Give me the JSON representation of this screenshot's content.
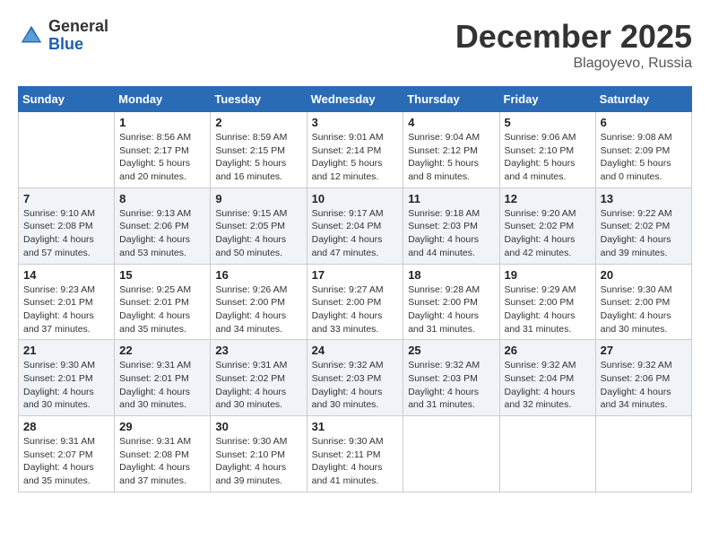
{
  "logo": {
    "general": "General",
    "blue": "Blue"
  },
  "title": "December 2025",
  "location": "Blagoyevo, Russia",
  "days_of_week": [
    "Sunday",
    "Monday",
    "Tuesday",
    "Wednesday",
    "Thursday",
    "Friday",
    "Saturday"
  ],
  "weeks": [
    [
      {
        "day": "",
        "info": ""
      },
      {
        "day": "1",
        "info": "Sunrise: 8:56 AM\nSunset: 2:17 PM\nDaylight: 5 hours\nand 20 minutes."
      },
      {
        "day": "2",
        "info": "Sunrise: 8:59 AM\nSunset: 2:15 PM\nDaylight: 5 hours\nand 16 minutes."
      },
      {
        "day": "3",
        "info": "Sunrise: 9:01 AM\nSunset: 2:14 PM\nDaylight: 5 hours\nand 12 minutes."
      },
      {
        "day": "4",
        "info": "Sunrise: 9:04 AM\nSunset: 2:12 PM\nDaylight: 5 hours\nand 8 minutes."
      },
      {
        "day": "5",
        "info": "Sunrise: 9:06 AM\nSunset: 2:10 PM\nDaylight: 5 hours\nand 4 minutes."
      },
      {
        "day": "6",
        "info": "Sunrise: 9:08 AM\nSunset: 2:09 PM\nDaylight: 5 hours\nand 0 minutes."
      }
    ],
    [
      {
        "day": "7",
        "info": "Sunrise: 9:10 AM\nSunset: 2:08 PM\nDaylight: 4 hours\nand 57 minutes."
      },
      {
        "day": "8",
        "info": "Sunrise: 9:13 AM\nSunset: 2:06 PM\nDaylight: 4 hours\nand 53 minutes."
      },
      {
        "day": "9",
        "info": "Sunrise: 9:15 AM\nSunset: 2:05 PM\nDaylight: 4 hours\nand 50 minutes."
      },
      {
        "day": "10",
        "info": "Sunrise: 9:17 AM\nSunset: 2:04 PM\nDaylight: 4 hours\nand 47 minutes."
      },
      {
        "day": "11",
        "info": "Sunrise: 9:18 AM\nSunset: 2:03 PM\nDaylight: 4 hours\nand 44 minutes."
      },
      {
        "day": "12",
        "info": "Sunrise: 9:20 AM\nSunset: 2:02 PM\nDaylight: 4 hours\nand 42 minutes."
      },
      {
        "day": "13",
        "info": "Sunrise: 9:22 AM\nSunset: 2:02 PM\nDaylight: 4 hours\nand 39 minutes."
      }
    ],
    [
      {
        "day": "14",
        "info": "Sunrise: 9:23 AM\nSunset: 2:01 PM\nDaylight: 4 hours\nand 37 minutes."
      },
      {
        "day": "15",
        "info": "Sunrise: 9:25 AM\nSunset: 2:01 PM\nDaylight: 4 hours\nand 35 minutes."
      },
      {
        "day": "16",
        "info": "Sunrise: 9:26 AM\nSunset: 2:00 PM\nDaylight: 4 hours\nand 34 minutes."
      },
      {
        "day": "17",
        "info": "Sunrise: 9:27 AM\nSunset: 2:00 PM\nDaylight: 4 hours\nand 33 minutes."
      },
      {
        "day": "18",
        "info": "Sunrise: 9:28 AM\nSunset: 2:00 PM\nDaylight: 4 hours\nand 31 minutes."
      },
      {
        "day": "19",
        "info": "Sunrise: 9:29 AM\nSunset: 2:00 PM\nDaylight: 4 hours\nand 31 minutes."
      },
      {
        "day": "20",
        "info": "Sunrise: 9:30 AM\nSunset: 2:00 PM\nDaylight: 4 hours\nand 30 minutes."
      }
    ],
    [
      {
        "day": "21",
        "info": "Sunrise: 9:30 AM\nSunset: 2:01 PM\nDaylight: 4 hours\nand 30 minutes."
      },
      {
        "day": "22",
        "info": "Sunrise: 9:31 AM\nSunset: 2:01 PM\nDaylight: 4 hours\nand 30 minutes."
      },
      {
        "day": "23",
        "info": "Sunrise: 9:31 AM\nSunset: 2:02 PM\nDaylight: 4 hours\nand 30 minutes."
      },
      {
        "day": "24",
        "info": "Sunrise: 9:32 AM\nSunset: 2:03 PM\nDaylight: 4 hours\nand 30 minutes."
      },
      {
        "day": "25",
        "info": "Sunrise: 9:32 AM\nSunset: 2:03 PM\nDaylight: 4 hours\nand 31 minutes."
      },
      {
        "day": "26",
        "info": "Sunrise: 9:32 AM\nSunset: 2:04 PM\nDaylight: 4 hours\nand 32 minutes."
      },
      {
        "day": "27",
        "info": "Sunrise: 9:32 AM\nSunset: 2:06 PM\nDaylight: 4 hours\nand 34 minutes."
      }
    ],
    [
      {
        "day": "28",
        "info": "Sunrise: 9:31 AM\nSunset: 2:07 PM\nDaylight: 4 hours\nand 35 minutes."
      },
      {
        "day": "29",
        "info": "Sunrise: 9:31 AM\nSunset: 2:08 PM\nDaylight: 4 hours\nand 37 minutes."
      },
      {
        "day": "30",
        "info": "Sunrise: 9:30 AM\nSunset: 2:10 PM\nDaylight: 4 hours\nand 39 minutes."
      },
      {
        "day": "31",
        "info": "Sunrise: 9:30 AM\nSunset: 2:11 PM\nDaylight: 4 hours\nand 41 minutes."
      },
      {
        "day": "",
        "info": ""
      },
      {
        "day": "",
        "info": ""
      },
      {
        "day": "",
        "info": ""
      }
    ]
  ]
}
